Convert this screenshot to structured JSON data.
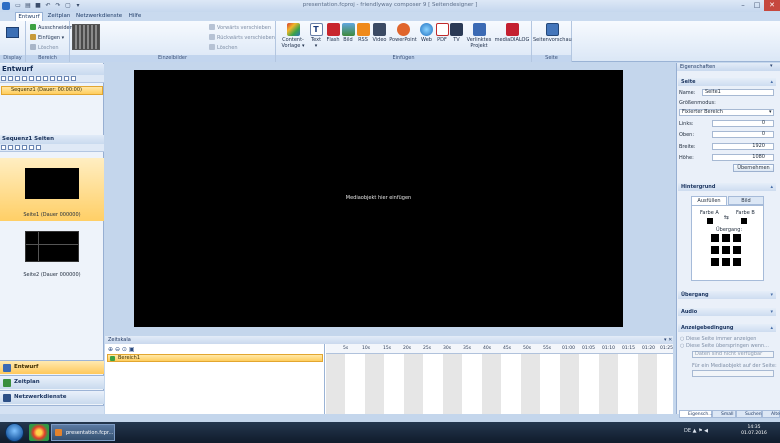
{
  "window": {
    "title": "presentation.fcproj - friendlyway composer 9 [ Seitendesigner ]"
  },
  "tabs": [
    "Entwurf",
    "Zeitplan",
    "Netzwerkdienste",
    "Hilfe"
  ],
  "ribbon": {
    "groups": {
      "display": "Display",
      "bereich": "Bereich",
      "einzelbilder": "Einzelbilder",
      "einfuegen": "Einfügen",
      "seite": "Seite"
    },
    "bereich": {
      "ausschneiden": "Ausschneiden",
      "einfuegen": "Einfügen",
      "loeschen": "Löschen"
    },
    "einzelbilder": {
      "vorwaerts": "Vorwärts verschieben",
      "rueckwaerts": "Rückwärts verschieben",
      "loeschen": "Löschen"
    },
    "insert": {
      "content": "Content-",
      "content2": "Vorlage",
      "text": "Text",
      "flash": "Flash",
      "bild": "Bild",
      "rss": "RSS",
      "video": "Video",
      "powerpoint": "PowerPoint",
      "web": "Web",
      "pdf": "PDF",
      "tv": "TV",
      "verlinktes": "Verlinktes",
      "verlinktes2": "Projekt",
      "mediadialog": "mediaDIALOG"
    },
    "seite": {
      "vorschau": "Seitenvorschau"
    }
  },
  "left": {
    "title": "Entwurf",
    "sequence": "Sequenz1 (Dauer: 00:00:00)",
    "pages_title": "Sequenz1 Seiten",
    "pages": [
      "Seite1 (Dauer 000000)",
      "Seite2 (Dauer 000000)"
    ],
    "nav": [
      "Entwurf",
      "Zeitplan",
      "Netzwerkdienste"
    ]
  },
  "canvas": {
    "placeholder": "Mediaobjekt hier einfügen"
  },
  "timeline": {
    "title": "Zeitskala",
    "layer": "Bereich1",
    "ticks": [
      "5s",
      "10s",
      "15s",
      "20s",
      "25s",
      "30s",
      "35s",
      "40s",
      "45s",
      "50s",
      "55s",
      "01:00",
      "01:05",
      "01:10",
      "01:15",
      "01:20",
      "01:25"
    ]
  },
  "properties": {
    "title": "Eigenschaften",
    "seite": {
      "head": "Seite",
      "name_label": "Name:",
      "name_value": "Seite1",
      "groessen_label": "Größenmodus:",
      "groessen_value": "Fixierter Bereich",
      "links_label": "Links:",
      "links_value": "0",
      "oben_label": "Oben:",
      "oben_value": "0",
      "breite_label": "Breite:",
      "breite_value": "1920",
      "hoehe_label": "Höhe:",
      "hoehe_value": "1080",
      "uebernehmen": "Übernehmen"
    },
    "hintergrund": {
      "head": "Hintergrund",
      "tab1": "Ausfüllen",
      "tab2": "Bild",
      "farbe_a": "Farbe A",
      "farbe_b": "Farbe B",
      "uebergang": "Übergang:"
    },
    "uebergang_head": "Übergang",
    "audio_head": "Audio",
    "anzeige": {
      "head": "Anzeigebedingung",
      "opt1": "Diese Seite immer anzeigen",
      "opt2": "Diese Seite überspringen wenn...",
      "select": "Daten sind nicht verfügbar",
      "label": "Für ein Mediaobjekt auf der Seite:"
    },
    "bottom_tabs": [
      "Eigensch...",
      "Small",
      "Suchen",
      "Altern"
    ]
  },
  "taskbar": {
    "active": "presentation.fcpr...",
    "lang": "DE",
    "time": "14:35",
    "date": "01.07.2016"
  },
  "colors": {
    "ribbon": "#dbe7f6",
    "accent": "#ffcd5c",
    "canvas": "#000000"
  }
}
